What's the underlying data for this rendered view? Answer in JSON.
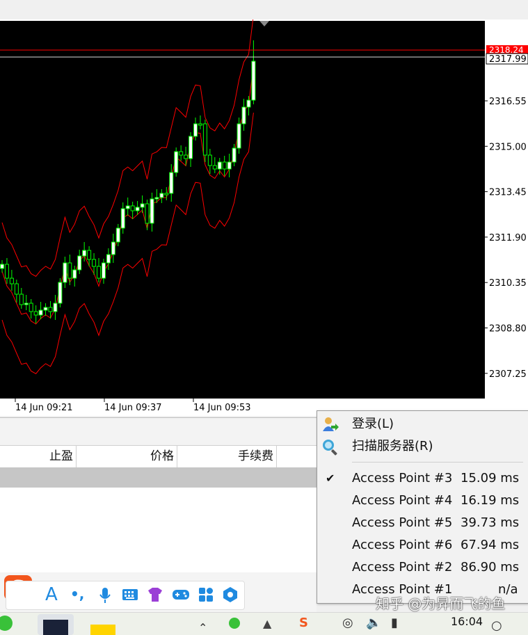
{
  "chart": {
    "current_price_label": "2317.99",
    "top_red_label": "2318.24",
    "y_ticks": [
      "2316.55",
      "2315.00",
      "2313.45",
      "2311.90",
      "2310.35",
      "2308.80",
      "2307.25"
    ],
    "x_ticks": [
      "14 Jun 09:21",
      "14 Jun 09:37",
      "14 Jun 09:53"
    ],
    "colors": {
      "background": "#000000",
      "candle_bull": "#00ff00",
      "candle_body": "#ffffff",
      "bands": "#ff0000",
      "price_line_red": "#ff0000",
      "price_line_white": "#dcdcdc"
    }
  },
  "columns": {
    "take_profit": "止盈",
    "price": "价格",
    "commission": "手续费"
  },
  "context_menu": {
    "login": "登录(L)",
    "scan_servers": "扫描服务器(R)",
    "access_points": [
      {
        "name": "Access Point #3",
        "ping": "15.09 ms",
        "checked": true
      },
      {
        "name": "Access Point #4",
        "ping": "16.19 ms",
        "checked": false
      },
      {
        "name": "Access Point #5",
        "ping": "39.73 ms",
        "checked": false
      },
      {
        "name": "Access Point #6",
        "ping": "67.94 ms",
        "checked": false
      },
      {
        "name": "Access Point #2",
        "ping": "86.90 ms",
        "checked": false
      },
      {
        "name": "Access Point #1",
        "ping": "n/a",
        "checked": false
      }
    ]
  },
  "ime_toolbar": {
    "logo": "S",
    "icons": [
      "letter-a-icon",
      "punctuation-icon",
      "microphone-icon",
      "keyboard-icon",
      "skin-icon",
      "gamepad-icon",
      "apps-icon",
      "settings-icon"
    ]
  },
  "taskbar": {
    "clock": "16:04"
  },
  "watermark": "知乎 @为昇而飞的鱼"
}
